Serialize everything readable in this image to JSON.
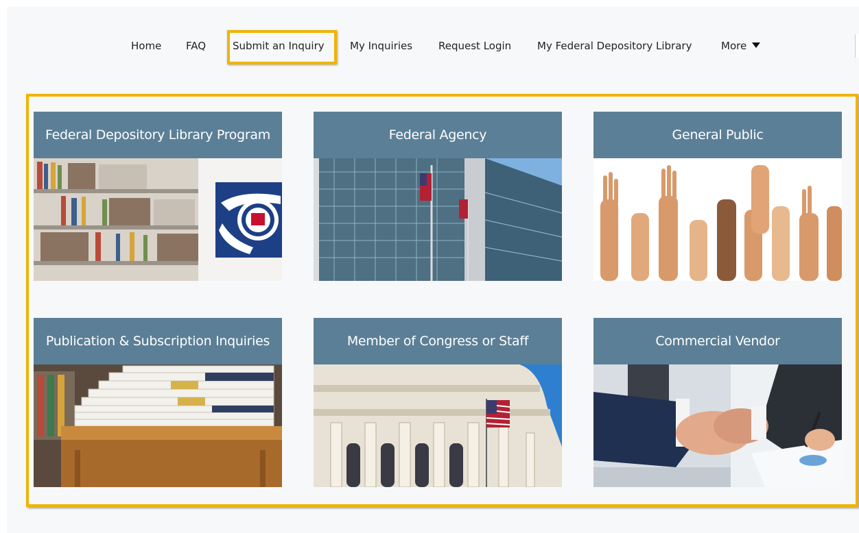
{
  "nav": {
    "items": [
      {
        "label": "Home"
      },
      {
        "label": "FAQ"
      },
      {
        "label": "Submit an Inquiry"
      },
      {
        "label": "My Inquiries"
      },
      {
        "label": "Request Login"
      },
      {
        "label": "My Federal Depository Library"
      },
      {
        "label": "More"
      }
    ],
    "highlighted": "Submit an Inquiry"
  },
  "cards": [
    {
      "title": "Federal Depository Library Program",
      "image": "library-shelves-with-fdlp-eagle-logo"
    },
    {
      "title": "Federal Agency",
      "image": "glass-office-building-with-flags"
    },
    {
      "title": "General Public",
      "image": "raised-hands"
    },
    {
      "title": "Publication & Subscription Inquiries",
      "image": "stacked-books-on-table"
    },
    {
      "title": "Member of Congress or Staff",
      "image": "capitol-dome-with-flag"
    },
    {
      "title": "Commercial Vendor",
      "image": "business-handshake"
    }
  ],
  "colors": {
    "highlight": "#f0b400",
    "card_header": "#5b7f96",
    "background": "#f7f8fa"
  }
}
